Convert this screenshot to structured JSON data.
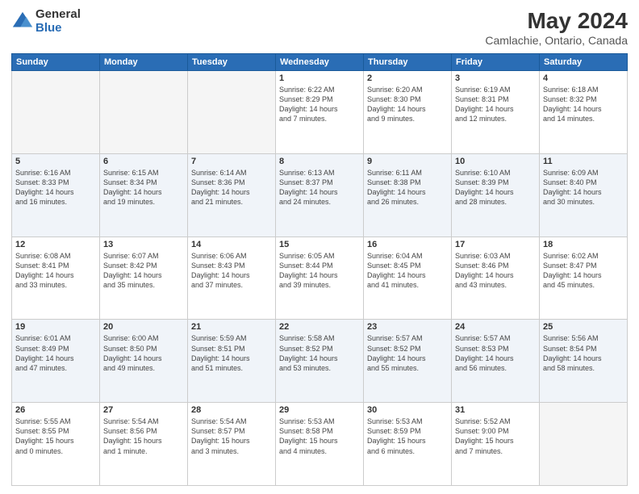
{
  "header": {
    "logo_general": "General",
    "logo_blue": "Blue",
    "month_year": "May 2024",
    "location": "Camlachie, Ontario, Canada"
  },
  "days_of_week": [
    "Sunday",
    "Monday",
    "Tuesday",
    "Wednesday",
    "Thursday",
    "Friday",
    "Saturday"
  ],
  "weeks": [
    [
      {
        "day": "",
        "info": ""
      },
      {
        "day": "",
        "info": ""
      },
      {
        "day": "",
        "info": ""
      },
      {
        "day": "1",
        "info": "Sunrise: 6:22 AM\nSunset: 8:29 PM\nDaylight: 14 hours\nand 7 minutes."
      },
      {
        "day": "2",
        "info": "Sunrise: 6:20 AM\nSunset: 8:30 PM\nDaylight: 14 hours\nand 9 minutes."
      },
      {
        "day": "3",
        "info": "Sunrise: 6:19 AM\nSunset: 8:31 PM\nDaylight: 14 hours\nand 12 minutes."
      },
      {
        "day": "4",
        "info": "Sunrise: 6:18 AM\nSunset: 8:32 PM\nDaylight: 14 hours\nand 14 minutes."
      }
    ],
    [
      {
        "day": "5",
        "info": "Sunrise: 6:16 AM\nSunset: 8:33 PM\nDaylight: 14 hours\nand 16 minutes."
      },
      {
        "day": "6",
        "info": "Sunrise: 6:15 AM\nSunset: 8:34 PM\nDaylight: 14 hours\nand 19 minutes."
      },
      {
        "day": "7",
        "info": "Sunrise: 6:14 AM\nSunset: 8:36 PM\nDaylight: 14 hours\nand 21 minutes."
      },
      {
        "day": "8",
        "info": "Sunrise: 6:13 AM\nSunset: 8:37 PM\nDaylight: 14 hours\nand 24 minutes."
      },
      {
        "day": "9",
        "info": "Sunrise: 6:11 AM\nSunset: 8:38 PM\nDaylight: 14 hours\nand 26 minutes."
      },
      {
        "day": "10",
        "info": "Sunrise: 6:10 AM\nSunset: 8:39 PM\nDaylight: 14 hours\nand 28 minutes."
      },
      {
        "day": "11",
        "info": "Sunrise: 6:09 AM\nSunset: 8:40 PM\nDaylight: 14 hours\nand 30 minutes."
      }
    ],
    [
      {
        "day": "12",
        "info": "Sunrise: 6:08 AM\nSunset: 8:41 PM\nDaylight: 14 hours\nand 33 minutes."
      },
      {
        "day": "13",
        "info": "Sunrise: 6:07 AM\nSunset: 8:42 PM\nDaylight: 14 hours\nand 35 minutes."
      },
      {
        "day": "14",
        "info": "Sunrise: 6:06 AM\nSunset: 8:43 PM\nDaylight: 14 hours\nand 37 minutes."
      },
      {
        "day": "15",
        "info": "Sunrise: 6:05 AM\nSunset: 8:44 PM\nDaylight: 14 hours\nand 39 minutes."
      },
      {
        "day": "16",
        "info": "Sunrise: 6:04 AM\nSunset: 8:45 PM\nDaylight: 14 hours\nand 41 minutes."
      },
      {
        "day": "17",
        "info": "Sunrise: 6:03 AM\nSunset: 8:46 PM\nDaylight: 14 hours\nand 43 minutes."
      },
      {
        "day": "18",
        "info": "Sunrise: 6:02 AM\nSunset: 8:47 PM\nDaylight: 14 hours\nand 45 minutes."
      }
    ],
    [
      {
        "day": "19",
        "info": "Sunrise: 6:01 AM\nSunset: 8:49 PM\nDaylight: 14 hours\nand 47 minutes."
      },
      {
        "day": "20",
        "info": "Sunrise: 6:00 AM\nSunset: 8:50 PM\nDaylight: 14 hours\nand 49 minutes."
      },
      {
        "day": "21",
        "info": "Sunrise: 5:59 AM\nSunset: 8:51 PM\nDaylight: 14 hours\nand 51 minutes."
      },
      {
        "day": "22",
        "info": "Sunrise: 5:58 AM\nSunset: 8:52 PM\nDaylight: 14 hours\nand 53 minutes."
      },
      {
        "day": "23",
        "info": "Sunrise: 5:57 AM\nSunset: 8:52 PM\nDaylight: 14 hours\nand 55 minutes."
      },
      {
        "day": "24",
        "info": "Sunrise: 5:57 AM\nSunset: 8:53 PM\nDaylight: 14 hours\nand 56 minutes."
      },
      {
        "day": "25",
        "info": "Sunrise: 5:56 AM\nSunset: 8:54 PM\nDaylight: 14 hours\nand 58 minutes."
      }
    ],
    [
      {
        "day": "26",
        "info": "Sunrise: 5:55 AM\nSunset: 8:55 PM\nDaylight: 15 hours\nand 0 minutes."
      },
      {
        "day": "27",
        "info": "Sunrise: 5:54 AM\nSunset: 8:56 PM\nDaylight: 15 hours\nand 1 minute."
      },
      {
        "day": "28",
        "info": "Sunrise: 5:54 AM\nSunset: 8:57 PM\nDaylight: 15 hours\nand 3 minutes."
      },
      {
        "day": "29",
        "info": "Sunrise: 5:53 AM\nSunset: 8:58 PM\nDaylight: 15 hours\nand 4 minutes."
      },
      {
        "day": "30",
        "info": "Sunrise: 5:53 AM\nSunset: 8:59 PM\nDaylight: 15 hours\nand 6 minutes."
      },
      {
        "day": "31",
        "info": "Sunrise: 5:52 AM\nSunset: 9:00 PM\nDaylight: 15 hours\nand 7 minutes."
      },
      {
        "day": "",
        "info": ""
      }
    ]
  ]
}
